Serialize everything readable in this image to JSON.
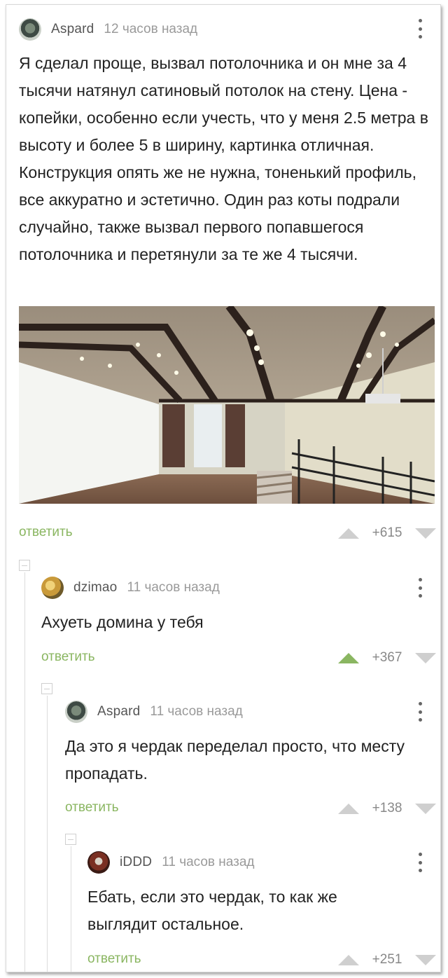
{
  "comments": [
    {
      "username": "Aspard",
      "time": "12 часов назад",
      "text": "Я сделал проще, вызвал потолочника и он мне за 4 тысячи натянул сатиновый потолок на стену. Цена - копейки, особенно если учесть, что у меня 2.5 метра в высоту и более 5 в ширину, картинка отличная. Конструкция опять же не нужна, тоненький профиль, все аккуратно и эстетично. Один раз коты подрали случайно, также вызвал первого попавшегося потолочника и перетянули за те же 4 тысячи.",
      "reply_label": "ответить",
      "score": "+615"
    },
    {
      "username": "dzimao",
      "time": "11 часов назад",
      "text": "Ахуеть домина у тебя",
      "reply_label": "ответить",
      "score": "+367"
    },
    {
      "username": "Aspard",
      "time": "11 часов назад",
      "text": "Да это я чердак переделал просто, что месту пропадать.",
      "reply_label": "ответить",
      "score": "+138"
    },
    {
      "username": "iDDD",
      "time": "11 часов назад",
      "text": "Ебать, если это чердак, то как же выглядит остальное.",
      "reply_label": "ответить",
      "score": "+251"
    }
  ],
  "colors": {
    "accent_green": "#8ab661",
    "arrow_gray": "#cfcfcf"
  }
}
